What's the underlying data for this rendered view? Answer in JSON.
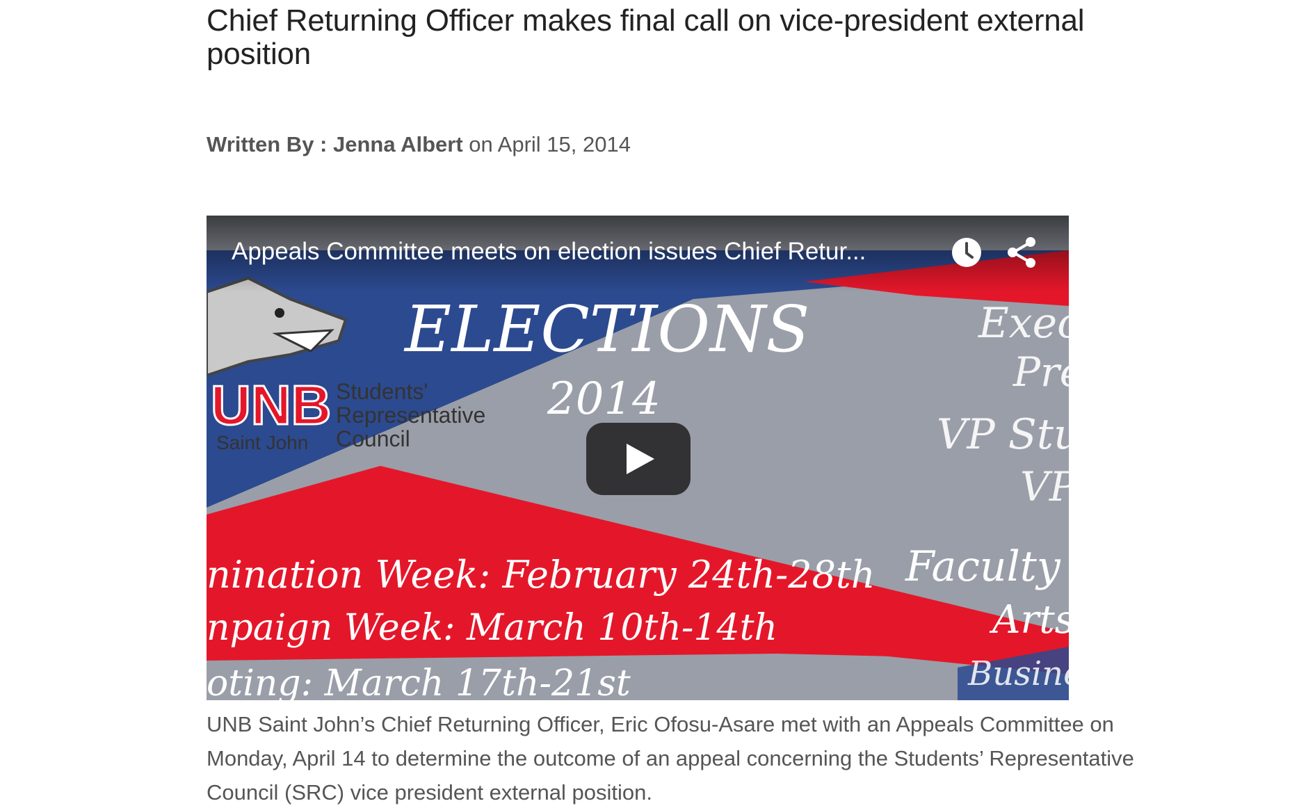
{
  "article": {
    "headline": "Chief Returning Officer makes final call on vice-president external position",
    "byline": {
      "label": "Written By :",
      "author": "Jenna Albert",
      "on": "on",
      "date": "April 15, 2014"
    },
    "video": {
      "title": "Appeals Committee meets on election issues Chief Retur...",
      "watch_later_icon": "clock-icon",
      "share_icon": "share-icon",
      "play_icon": "play-icon",
      "thumbnail": {
        "heading": "ELECTIONS",
        "year": "2014",
        "logo_text": "UNB",
        "logo_sub": "Saint John",
        "council_line1": "Students'",
        "council_line2": "Representative",
        "council_line3": "Council",
        "schedule_line1": "nination Week: February 24th-28th",
        "schedule_line2": "npaign Week: March 10th-14th",
        "schedule_line3": "oting: March 17th-21st",
        "right_col_1": "Exec",
        "right_col_2": "Pre",
        "right_col_3": "VP Stu",
        "right_col_4": "VP",
        "right_col_5": "Faculty",
        "right_col_6": "Arts",
        "right_col_7": "Busine"
      },
      "colors": {
        "blue": "#2c4a8f",
        "red": "#e4172a",
        "grey": "#9a9ea8"
      }
    },
    "paragraph": "UNB Saint John’s Chief Returning Officer, Eric Ofosu-Asare met with an Appeals Committee on Monday, April 14 to determine the outcome of an appeal concerning the Students’ Representative Council (SRC) vice president external position."
  }
}
